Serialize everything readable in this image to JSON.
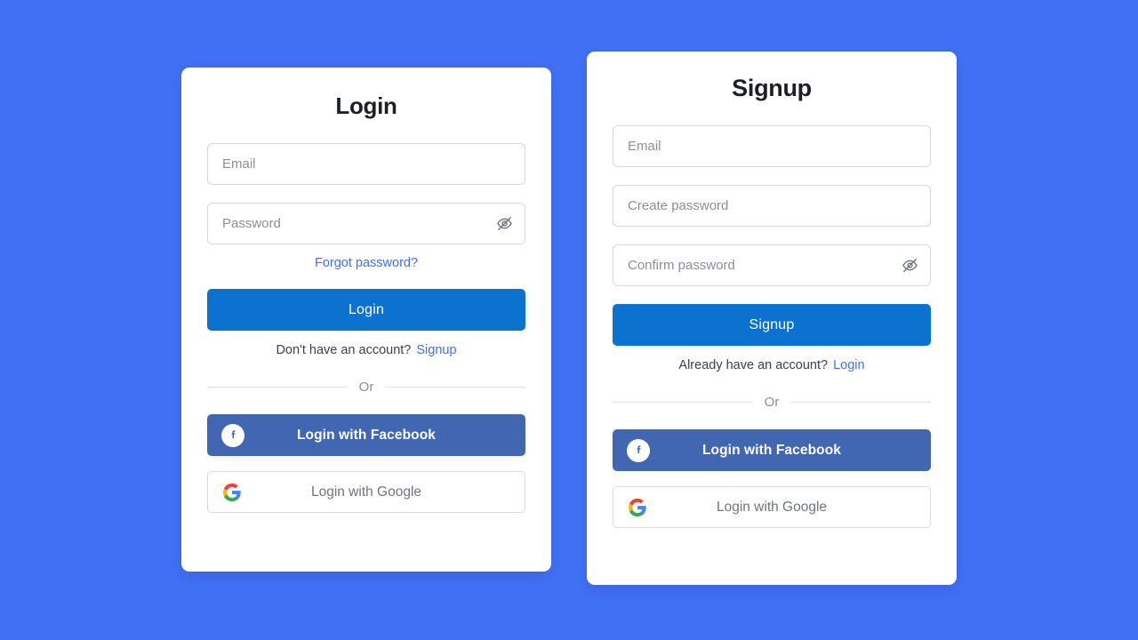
{
  "background_color": "#4070f4",
  "accent_color": "#4070f4",
  "primary_button_color": "#0b72d0",
  "facebook_color": "#4267b2",
  "login_card": {
    "title": "Login",
    "email": {
      "placeholder": "Email",
      "value": ""
    },
    "password": {
      "placeholder": "Password",
      "value": ""
    },
    "toggle_password_icon": "eye-off-icon",
    "forgot_password_label": "Forgot password?",
    "submit_label": "Login",
    "switch_prompt": "Don't have an account?",
    "switch_link_label": "Signup",
    "divider_label": "Or",
    "facebook_label": "Login with Facebook",
    "facebook_icon": "facebook-icon",
    "google_label": "Login with Google",
    "google_icon": "google-icon"
  },
  "signup_card": {
    "title": "Signup",
    "email": {
      "placeholder": "Email",
      "value": ""
    },
    "create_password": {
      "placeholder": "Create password",
      "value": ""
    },
    "confirm_password": {
      "placeholder": "Confirm password",
      "value": ""
    },
    "toggle_password_icon": "eye-off-icon",
    "submit_label": "Signup",
    "switch_prompt": "Already have an account?",
    "switch_link_label": "Login",
    "divider_label": "Or",
    "facebook_label": "Login with Facebook",
    "facebook_icon": "facebook-icon",
    "google_label": "Login with Google",
    "google_icon": "google-icon"
  }
}
